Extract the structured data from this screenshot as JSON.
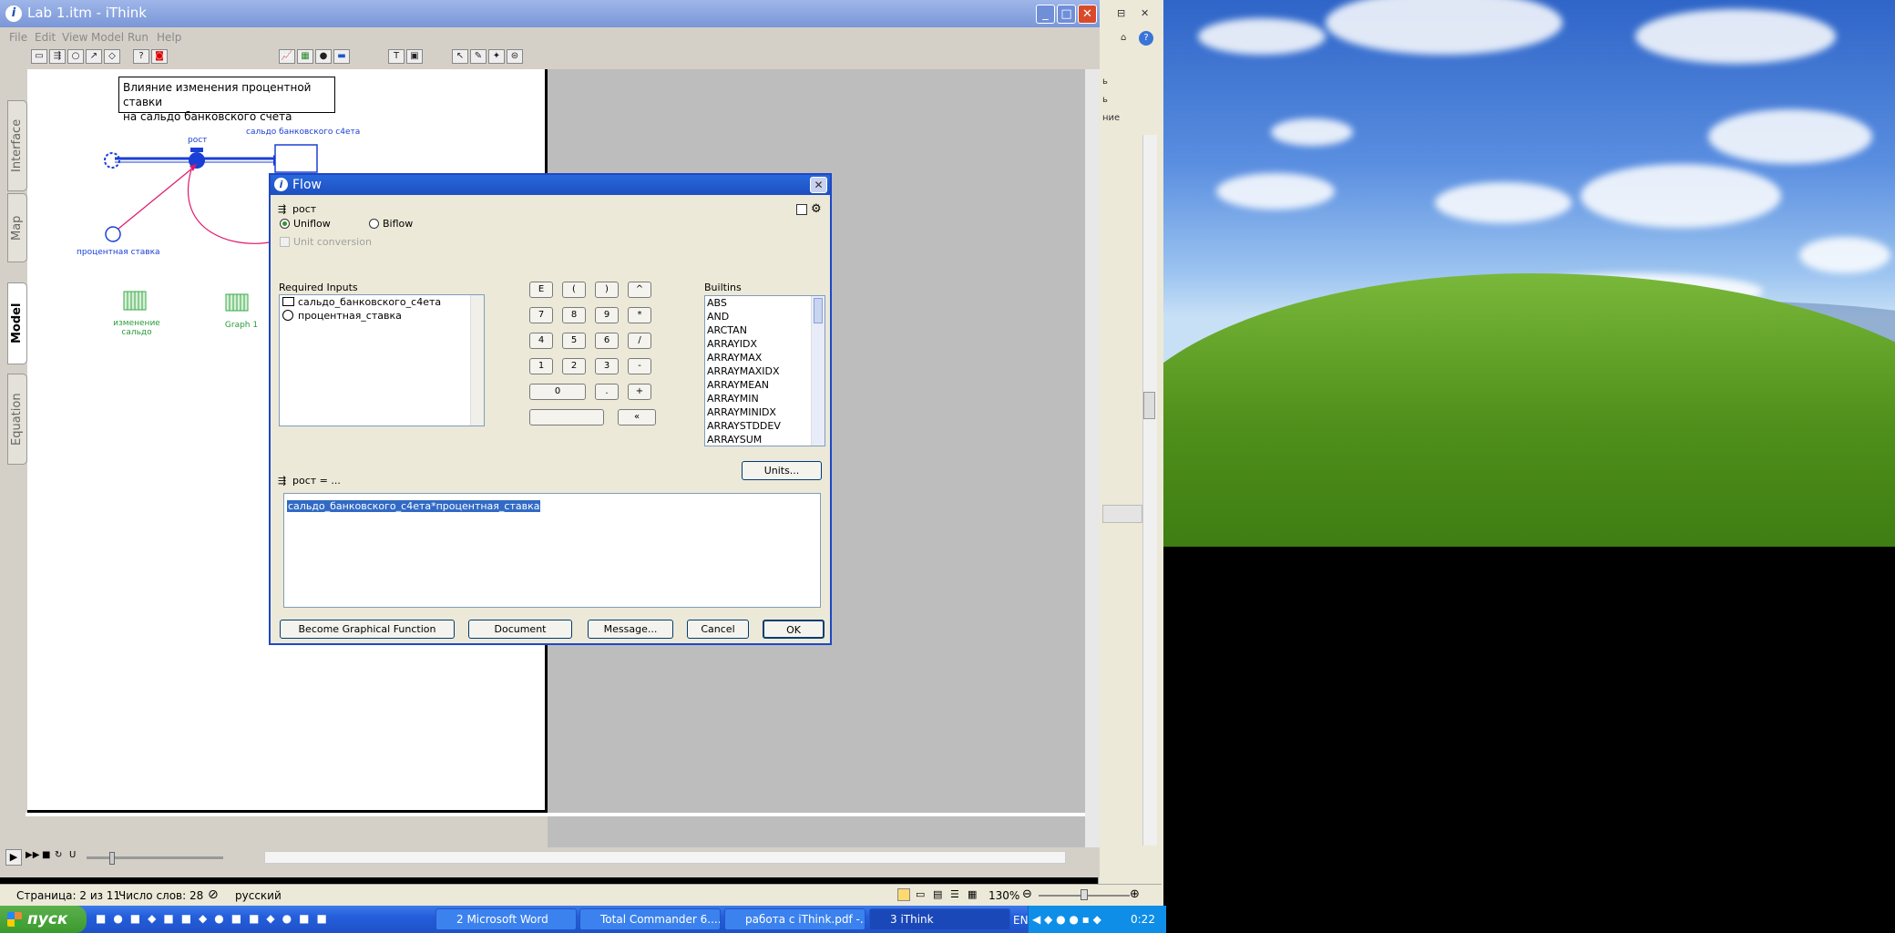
{
  "window": {
    "title": "Lab 1.itm - iThink"
  },
  "menu": [
    "File",
    "Edit",
    "View",
    "Model",
    "Run",
    "Help"
  ],
  "side_tabs": [
    "Interface",
    "Map",
    "Model",
    "Equation"
  ],
  "model": {
    "note_line1": "Влияние изменения процентной ставки",
    "note_line2": "на сальдо банковского счета",
    "flow_label": "рост",
    "stock_label": "сальдо банковского с4ета",
    "converter_label": "процентная ставка",
    "table_label_1": "изменение",
    "table_label_2": "сальдо",
    "graph_label": "Graph 1"
  },
  "dialog": {
    "title": "Flow",
    "flow_name": "рост",
    "uniflow": "Uniflow",
    "biflow": "Biflow",
    "unit_conversion": "Unit conversion",
    "required_inputs_label": "Required Inputs",
    "required_inputs": [
      "сальдо_банковского_с4ета",
      "процентная_ставка"
    ],
    "builtins_label": "Builtins",
    "builtins": [
      "ABS",
      "AND",
      "ARCTAN",
      "ARRAYIDX",
      "ARRAYMAX",
      "ARRAYMAXIDX",
      "ARRAYMEAN",
      "ARRAYMIN",
      "ARRAYMINIDX",
      "ARRAYSTDDEV",
      "ARRAYSUM"
    ],
    "keypad_row1": [
      "E",
      "(",
      ")",
      "^"
    ],
    "keypad_row2": [
      "7",
      "8",
      "9",
      "*"
    ],
    "keypad_row3": [
      "4",
      "5",
      "6",
      "/"
    ],
    "keypad_row4": [
      "1",
      "2",
      "3",
      "-"
    ],
    "keypad_zero": "0",
    "keypad_dot": ".",
    "keypad_plus": "+",
    "keypad_back": "«",
    "units_button": "Units...",
    "equation_label": "рост = ...",
    "equation": "сальдо_банковского_с4ета*процентная_ставка",
    "buttons": {
      "graphical": "Become Graphical Function",
      "document": "Document",
      "message": "Message...",
      "cancel": "Cancel",
      "ok": "OK"
    }
  },
  "statusbar": {
    "page": "Страница: 2 из 11",
    "words": "Число слов: 28",
    "language": "русский",
    "zoom": "130%"
  },
  "taskbar": {
    "start": "пуск",
    "tasks": [
      "2 Microsoft Word",
      "Total Commander 6....",
      "работа с iThink.pdf -...",
      "3 iThink"
    ],
    "lang": "EN",
    "clock": "0:22"
  },
  "word_side": [
    "ь",
    "ь",
    "ние"
  ]
}
